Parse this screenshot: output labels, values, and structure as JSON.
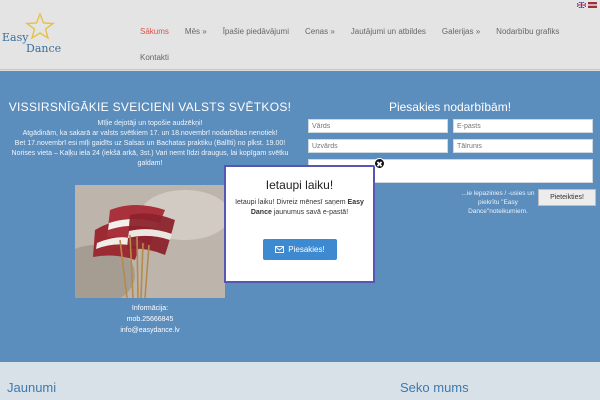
{
  "header": {
    "logo_line1": "Easy",
    "logo_line2": "Dance",
    "nav": [
      {
        "label": "Sākums",
        "active": true
      },
      {
        "label": "Mēs »"
      },
      {
        "label": "Īpašie piedāvājumi"
      },
      {
        "label": "Cenas »"
      },
      {
        "label": "Jautājumi un atbildes"
      },
      {
        "label": "Galerijas »"
      },
      {
        "label": "Nodarbību grafiks"
      },
      {
        "label": "Kontakti"
      }
    ]
  },
  "left": {
    "title": "VISSIRSNĪGĀKIE SVEICIENI VALSTS SVĒTKOS!",
    "lines": [
      "Mīļie dejotāji un topošie audzēkņi!",
      "Atgādinām, ka sakarā ar valsts svētkiem 17. un 18.novembrī nodarbības nenotiek!",
      "Bet 17.novembrī esi mīļi gaidīts uz Salsas un Bachatas praktiku (Ballīti) no plkst. 19.00!",
      "Norises vieta – Kaļķu iela 24 (iekšā arkā, 3st.) Vari nemt līdzi draugus, lai kopīgam svētku galdam!"
    ],
    "contact": [
      "Informācija:",
      "mob.25666845",
      "info@easydance.lv"
    ]
  },
  "right": {
    "title": "Piesakies nodarbībām!",
    "placeholders": {
      "name": "Vārds",
      "email": "E-pasts",
      "surname": "Uzvārds",
      "phone": "Tālrunis",
      "message": ""
    },
    "consent": "...ie lepazinies / -usies un piekrītu \"Easy Dance\"noteikumiem.",
    "submit": "Pieteikties!"
  },
  "bottom": {
    "left_title": "Jaunumi",
    "right_title": "Seko mums"
  },
  "popup": {
    "close": "✖",
    "title": "Ietaupi laiku!",
    "text_before": "Ietaupi laiku! Divreiz mēnesī saņem",
    "brand": "Easy Dance",
    "text_after": "jaunumus savā e-pastā!",
    "button": "Piesakies!"
  },
  "colors": {
    "blue": "#5b8dbd",
    "accent": "#3d8ad0",
    "active_nav": "#d9534f"
  }
}
